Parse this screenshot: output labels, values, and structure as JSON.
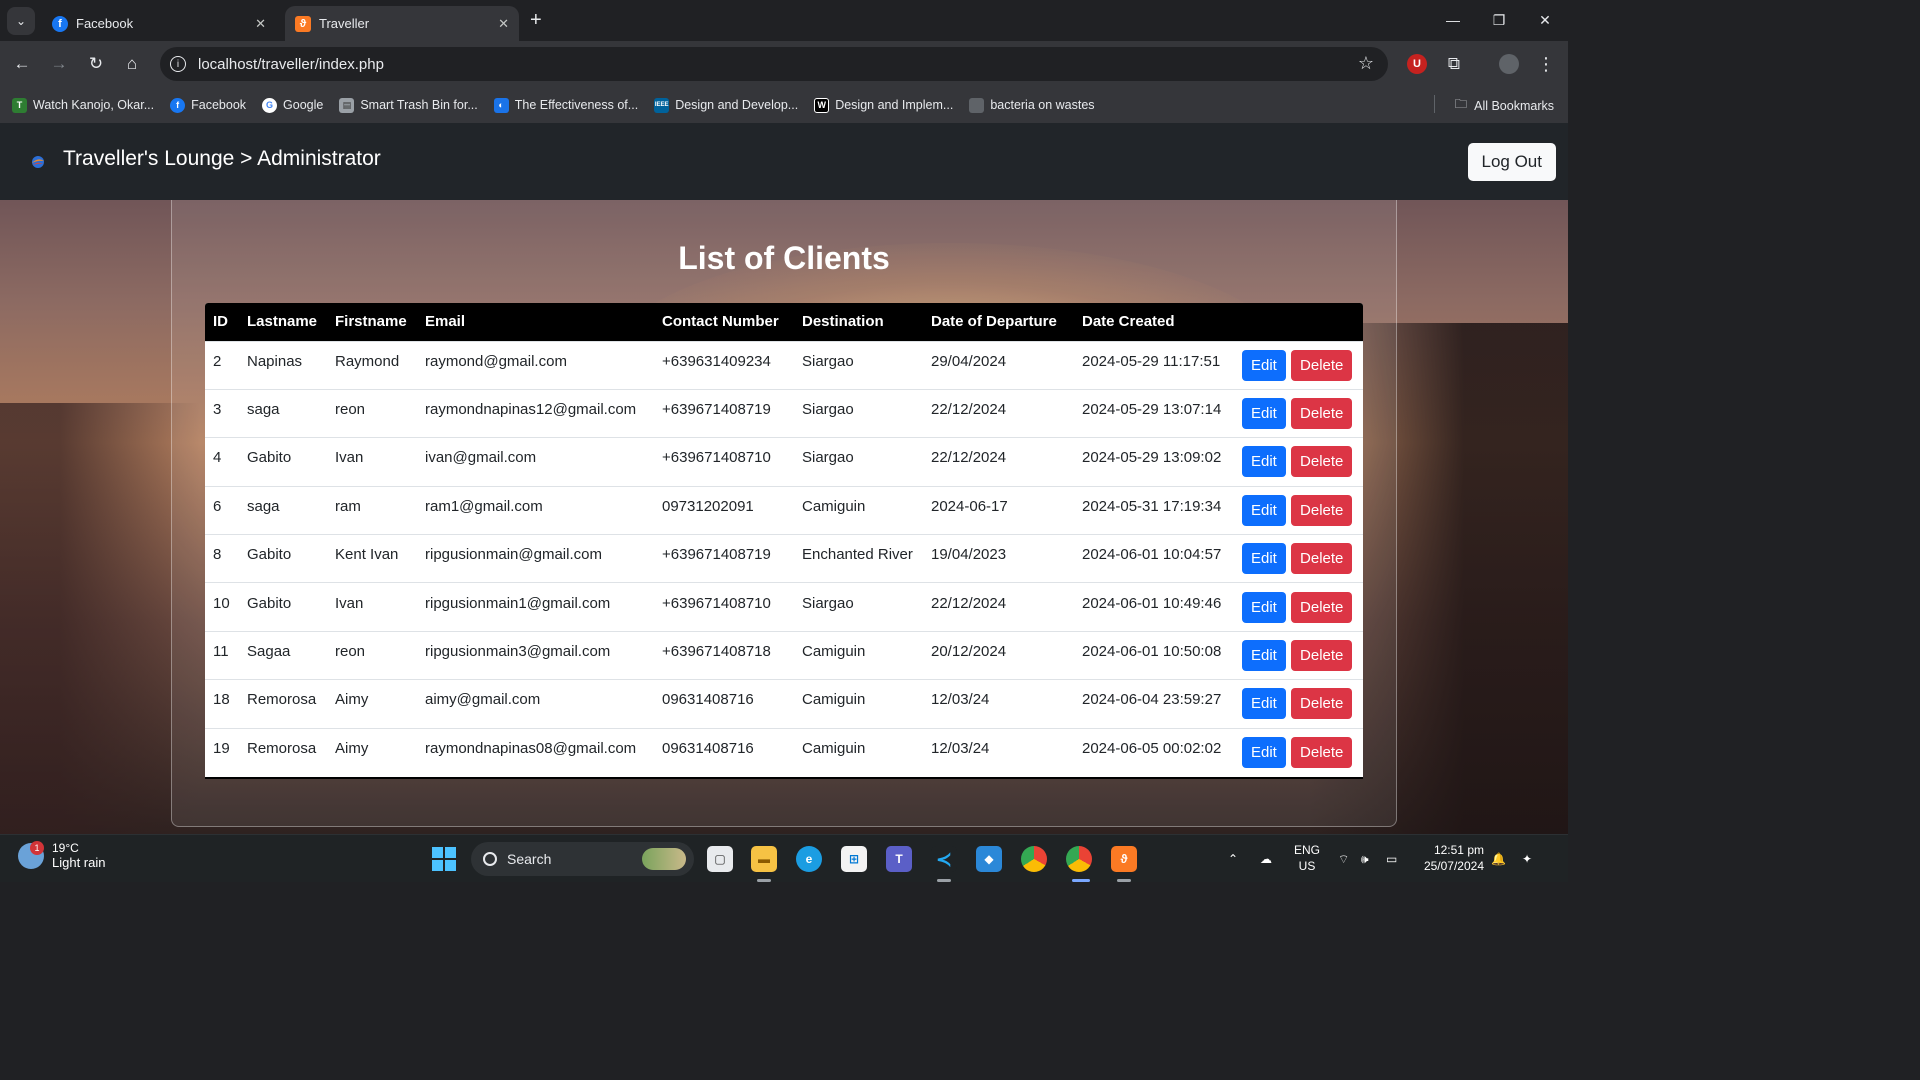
{
  "browser": {
    "tabs": [
      {
        "title": "Facebook",
        "icon": "facebook-icon",
        "active": false
      },
      {
        "title": "Traveller",
        "icon": "xampp-icon",
        "active": true
      }
    ],
    "url": "localhost/traveller/index.php",
    "bookmarks": [
      {
        "label": "Watch Kanojo, Okar...",
        "icon": "tv-icon",
        "color": "#2e7d32"
      },
      {
        "label": "Facebook",
        "icon": "facebook-icon",
        "color": "#1877f2"
      },
      {
        "label": "Google",
        "icon": "google-icon",
        "color": "#ffffff"
      },
      {
        "label": "Smart Trash Bin for...",
        "icon": "document-icon",
        "color": "#9aa0a6"
      },
      {
        "label": "The Effectiveness of...",
        "icon": "globe-icon",
        "color": "#1a73e8"
      },
      {
        "label": "Design and Develop...",
        "icon": "ieee-icon",
        "color": "#00629b"
      },
      {
        "label": "Design and Implem...",
        "icon": "w-icon",
        "color": "#000000"
      },
      {
        "label": "bacteria on wastes",
        "icon": "page-icon",
        "color": "#5f6368"
      }
    ],
    "all_bookmarks": "All Bookmarks"
  },
  "app": {
    "brand": "Traveller's Lounge > Administrator",
    "logout_label": "Log Out",
    "heading": "List of Clients",
    "columns": [
      "ID",
      "Lastname",
      "Firstname",
      "Email",
      "Contact Number",
      "Destination",
      "Date of Departure",
      "Date Created",
      ""
    ],
    "edit_label": "Edit",
    "delete_label": "Delete",
    "rows": [
      {
        "id": "2",
        "lastname": "Napinas",
        "firstname": "Raymond",
        "email": "raymond@gmail.com",
        "contact": "+639631409234",
        "destination": "Siargao",
        "departure": "29/04/2024",
        "created": "2024-05-29 11:17:51"
      },
      {
        "id": "3",
        "lastname": "saga",
        "firstname": "reon",
        "email": "raymondnapinas12@gmail.com",
        "contact": "+639671408719",
        "destination": "Siargao",
        "departure": "22/12/2024",
        "created": "2024-05-29 13:07:14"
      },
      {
        "id": "4",
        "lastname": "Gabito",
        "firstname": "Ivan",
        "email": "ivan@gmail.com",
        "contact": "+639671408710",
        "destination": "Siargao",
        "departure": "22/12/2024",
        "created": "2024-05-29 13:09:02"
      },
      {
        "id": "6",
        "lastname": "saga",
        "firstname": "ram",
        "email": "ram1@gmail.com",
        "contact": "09731202091",
        "destination": "Camiguin",
        "departure": "2024-06-17",
        "created": "2024-05-31 17:19:34"
      },
      {
        "id": "8",
        "lastname": "Gabito",
        "firstname": "Kent Ivan",
        "email": "ripgusionmain@gmail.com",
        "contact": "+639671408719",
        "destination": "Enchanted River",
        "departure": "19/04/2023",
        "created": "2024-06-01 10:04:57"
      },
      {
        "id": "10",
        "lastname": "Gabito",
        "firstname": "Ivan",
        "email": "ripgusionmain1@gmail.com",
        "contact": "+639671408710",
        "destination": "Siargao",
        "departure": "22/12/2024",
        "created": "2024-06-01 10:49:46"
      },
      {
        "id": "11",
        "lastname": "Sagaa",
        "firstname": "reon",
        "email": "ripgusionmain3@gmail.com",
        "contact": "+639671408718",
        "destination": "Camiguin",
        "departure": "20/12/2024",
        "created": "2024-06-01 10:50:08"
      },
      {
        "id": "18",
        "lastname": "Remorosa",
        "firstname": "Aimy",
        "email": "aimy@gmail.com",
        "contact": "09631408716",
        "destination": "Camiguin",
        "departure": "12/03/24",
        "created": "2024-06-04 23:59:27"
      },
      {
        "id": "19",
        "lastname": "Remorosa",
        "firstname": "Aimy",
        "email": "raymondnapinas08@gmail.com",
        "contact": "09631408716",
        "destination": "Camiguin",
        "departure": "12/03/24",
        "created": "2024-06-05 00:02:02"
      }
    ]
  },
  "taskbar": {
    "weather_temp": "19°C",
    "weather_desc": "Light rain",
    "weather_badge": "1",
    "search_label": "Search",
    "lang_top": "ENG",
    "lang_bottom": "US",
    "time": "12:51 pm",
    "date": "25/07/2024"
  },
  "colors": {
    "edit": "#0d6efd",
    "delete": "#dc3545",
    "navbar": "#212529",
    "table_header": "#000000"
  }
}
